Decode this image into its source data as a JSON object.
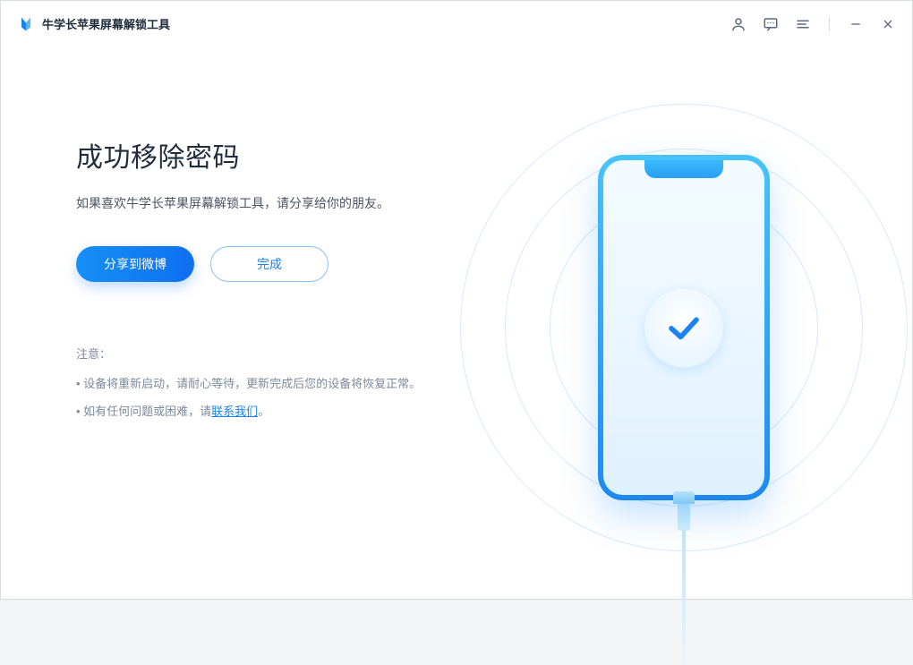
{
  "titlebar": {
    "app_name": "牛学长苹果屏幕解锁工具"
  },
  "main": {
    "headline": "成功移除密码",
    "subline": "如果喜欢牛学长苹果屏幕解锁工具，请分享给你的朋友。",
    "share_button": "分享到微博",
    "done_button": "完成"
  },
  "notes": {
    "title": "注意：",
    "line1": "• 设备将重新启动，请耐心等待，更新完成后您的设备将恢复正常。",
    "line2_prefix": "• 如有任何问题或困难，请",
    "line2_link": "联系我们",
    "line2_suffix": "。"
  }
}
